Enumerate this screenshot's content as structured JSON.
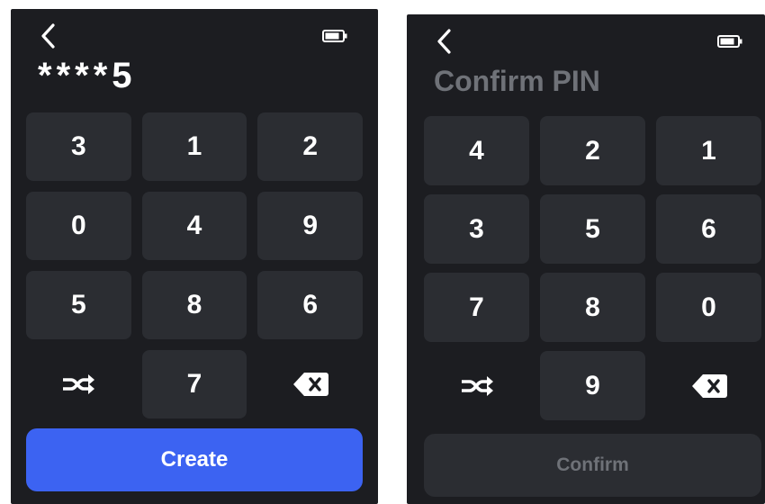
{
  "create_screen": {
    "pin_display": "****5",
    "keys": [
      "3",
      "1",
      "2",
      "0",
      "4",
      "9",
      "5",
      "8",
      "6",
      "7"
    ],
    "action_label": "Create"
  },
  "confirm_screen": {
    "title": "Confirm PIN",
    "keys": [
      "4",
      "2",
      "1",
      "3",
      "5",
      "6",
      "7",
      "8",
      "0",
      "9"
    ],
    "action_label": "Confirm"
  },
  "icons": {
    "back": "chevron-left-icon",
    "battery": "battery-icon",
    "shuffle": "shuffle-icon",
    "delete": "backspace-icon"
  },
  "colors": {
    "background": "#1c1d21",
    "key": "#2b2d32",
    "accent": "#3c63f2",
    "muted_text": "#6f7278"
  }
}
